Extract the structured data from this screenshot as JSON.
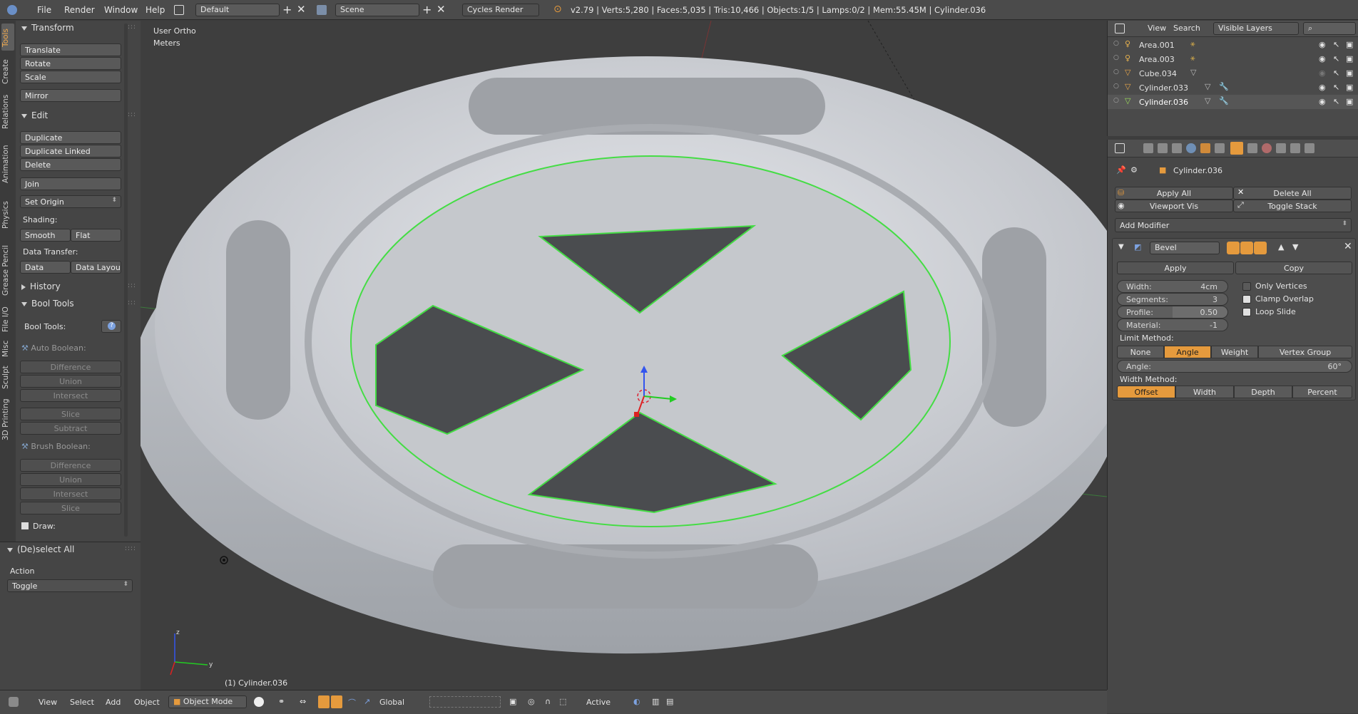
{
  "header": {
    "menus": [
      "File",
      "Render",
      "Window",
      "Help"
    ],
    "screen_layout": "Default",
    "scene": "Scene",
    "render_engine": "Cycles Render",
    "info": "v2.79 | Verts:5,280 | Faces:5,035 | Tris:10,466 | Objects:1/5 | Lamps:0/2 | Mem:55.45M | Cylinder.036"
  },
  "tabs": [
    "Tools",
    "Create",
    "Relations",
    "Animation",
    "Physics",
    "Grease Pencil",
    "File I/O",
    "Misc",
    "Sculpt",
    "3D Printing"
  ],
  "tool_shelf": {
    "transform": {
      "title": "Transform",
      "buttons": [
        "Translate",
        "Rotate",
        "Scale",
        "Mirror"
      ]
    },
    "edit": {
      "title": "Edit",
      "buttons": [
        "Duplicate",
        "Duplicate Linked",
        "Delete",
        "Join"
      ],
      "set_origin": "Set Origin",
      "shading_label": "Shading:",
      "smooth": "Smooth",
      "flat": "Flat",
      "data_transfer_label": "Data Transfer:",
      "data": "Data",
      "data_layout": "Data Layout"
    },
    "history": {
      "title": "History"
    },
    "bool_tools": {
      "title": "Bool Tools",
      "label": "Bool Tools:",
      "auto_boolean": "Auto Boolean:",
      "auto_ops": [
        "Difference",
        "Union",
        "Intersect",
        "Slice",
        "Subtract"
      ],
      "brush_boolean": "Brush Boolean:",
      "brush_ops": [
        "Difference",
        "Union",
        "Intersect",
        "Slice"
      ],
      "draw": "Draw:"
    }
  },
  "operator_panel": {
    "title": "(De)select All",
    "action_label": "Action",
    "action_value": "Toggle"
  },
  "viewport": {
    "view_name": "User Ortho",
    "units": "Meters",
    "object_label": "(1) Cylinder.036"
  },
  "outliner": {
    "menus": [
      "View",
      "Search"
    ],
    "display_mode": "Visible Layers",
    "items": [
      {
        "name": "Area.001",
        "type": "lamp"
      },
      {
        "name": "Area.003",
        "type": "lamp"
      },
      {
        "name": "Cube.034",
        "type": "mesh"
      },
      {
        "name": "Cylinder.033",
        "type": "mesh"
      },
      {
        "name": "Cylinder.036",
        "type": "mesh",
        "selected": true
      }
    ]
  },
  "properties": {
    "object_name": "Cylinder.036",
    "apply_all": "Apply All",
    "delete_all": "Delete All",
    "viewport_vis": "Viewport Vis",
    "toggle_stack": "Toggle Stack",
    "add_modifier": "Add Modifier",
    "modifier": {
      "name": "Bevel",
      "apply": "Apply",
      "copy": "Copy",
      "width_label": "Width:",
      "width": "4cm",
      "segments_label": "Segments:",
      "segments": "3",
      "profile_label": "Profile:",
      "profile": "0.50",
      "material_label": "Material:",
      "material": "-1",
      "only_vertices": "Only Vertices",
      "clamp_overlap": "Clamp Overlap",
      "loop_slide": "Loop Slide",
      "limit_method_label": "Limit Method:",
      "limit_methods": [
        "None",
        "Angle",
        "Weight",
        "Vertex Group"
      ],
      "limit_method_active": "Angle",
      "angle_label": "Angle:",
      "angle": "60°",
      "width_method_label": "Width Method:",
      "width_methods": [
        "Offset",
        "Width",
        "Depth",
        "Percent"
      ],
      "width_method_active": "Offset"
    }
  },
  "bottom_bar": {
    "menus": [
      "View",
      "Select",
      "Add",
      "Object"
    ],
    "mode": "Object Mode",
    "orientation": "Global",
    "snap_target": "Active"
  },
  "colors": {
    "accent": "#e59a3d",
    "selection_outline": "#2ecc40",
    "background": "#3d3d3d"
  }
}
